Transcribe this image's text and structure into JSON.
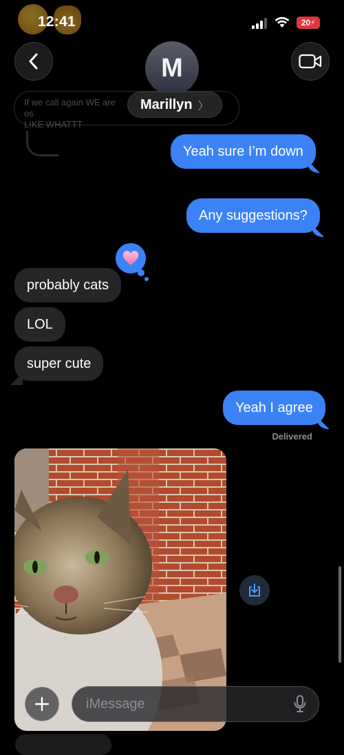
{
  "status_bar": {
    "time": "12:41",
    "battery": "20"
  },
  "header": {
    "avatar_initial": "M",
    "contact_name": "Marillyn",
    "name_chevron": "〉"
  },
  "reply_preview": {
    "text": "If we call again WE are",
    "text_suffix": "os",
    "text_line2": "LIKE WHATTT"
  },
  "messages": [
    {
      "side": "out",
      "text": "Yeah sure I’m down"
    },
    {
      "side": "out",
      "text": "Any suggestions?"
    },
    {
      "side": "in",
      "text": "probably cats"
    },
    {
      "side": "in",
      "text": "LOL"
    },
    {
      "side": "in",
      "text": "super cute"
    },
    {
      "side": "out",
      "text": "Yeah I agree"
    }
  ],
  "delivered_label": "Delivered",
  "tapback": {
    "icon": "pink-heart-icon"
  },
  "photo": {
    "description_icon": "cat-photo"
  },
  "composer": {
    "placeholder": "iMessage",
    "value": ""
  },
  "colors": {
    "outgoing": "#3b82f6",
    "incoming": "#262628",
    "background": "#000000"
  }
}
